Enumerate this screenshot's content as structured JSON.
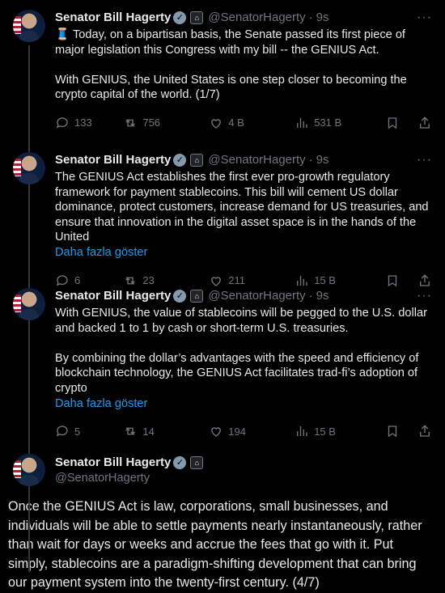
{
  "tweets": [
    {
      "name": "Senator Bill Hagerty",
      "handle": "@SenatorHagerty",
      "sep": "·",
      "time": "9s",
      "text": "🧵 Today, on a bipartisan basis, the Senate passed its first piece of major legislation this Congress with my bill -- the GENIUS Act.\n\nWith GENIUS, the United States is one step closer to becoming the crypto capital of the world. (1/7)",
      "show_more": "",
      "replies": "133",
      "reposts": "756",
      "likes": "4 B",
      "views": "531 B"
    },
    {
      "name": "Senator Bill Hagerty",
      "handle": "@SenatorHagerty",
      "sep": "·",
      "time": "9s",
      "text": "The GENIUS Act establishes the first ever pro-growth regulatory framework for payment stablecoins. This bill will cement US dollar dominance, protect customers, increase demand for US treasuries, and ensure that innovation in the digital asset space is in the hands of the United",
      "show_more": "Daha fazla göster",
      "replies": "6",
      "reposts": "23",
      "likes": "211",
      "views": "15 B"
    },
    {
      "name": "Senator Bill Hagerty",
      "handle": "@SenatorHagerty",
      "sep": "·",
      "time": "9s",
      "text": "With GENIUS, the value of stablecoins will be pegged to the U.S. dollar and backed 1 to 1 by cash or short-term U.S. treasuries.\n\nBy combining the dollar’s advantages with the speed and efficiency of blockchain technology, the GENIUS Act facilitates trad-fi’s adoption of crypto",
      "show_more": "Daha fazla göster",
      "replies": "5",
      "reposts": "14",
      "likes": "194",
      "views": "15 B"
    }
  ],
  "main": {
    "name": "Senator Bill Hagerty",
    "handle": "@SenatorHagerty",
    "text": "Once the GENIUS Act is law, corporations, small businesses, and individuals will be able to settle payments nearly instantaneously, rather than wait for days or weeks and accrue the fees that go with it. Put simply, stablecoins are a paradigm-shifting development that can bring our payment system into the twenty-first century. (4/7)"
  },
  "icons": {
    "verified": "verified-check-icon",
    "gov": "government-badge-icon",
    "more": "more-options-icon",
    "reply": "reply-icon",
    "repost": "repost-icon",
    "like": "like-icon",
    "views": "views-icon",
    "bookmark": "bookmark-icon",
    "share": "share-icon"
  },
  "colors": {
    "link": "#1d9bf0",
    "muted": "#71767b",
    "text": "#e7e9ea",
    "bg": "#000000"
  }
}
